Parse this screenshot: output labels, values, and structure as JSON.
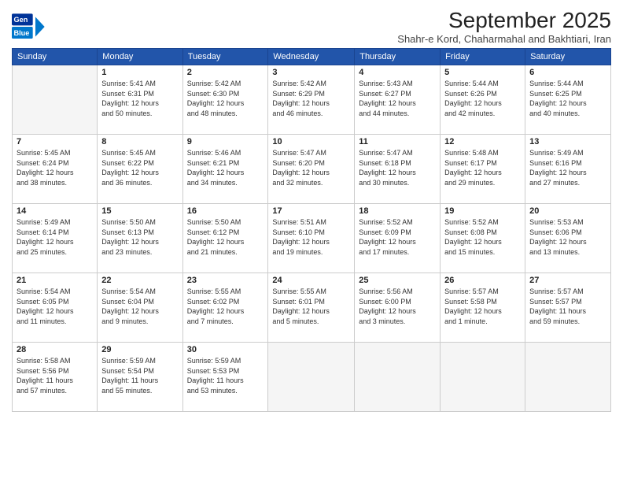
{
  "logo": {
    "line1": "General",
    "line2": "Blue"
  },
  "title": "September 2025",
  "subtitle": "Shahr-e Kord, Chaharmahal and Bakhtiari, Iran",
  "weekdays": [
    "Sunday",
    "Monday",
    "Tuesday",
    "Wednesday",
    "Thursday",
    "Friday",
    "Saturday"
  ],
  "weeks": [
    [
      {
        "day": "",
        "info": ""
      },
      {
        "day": "1",
        "info": "Sunrise: 5:41 AM\nSunset: 6:31 PM\nDaylight: 12 hours\nand 50 minutes."
      },
      {
        "day": "2",
        "info": "Sunrise: 5:42 AM\nSunset: 6:30 PM\nDaylight: 12 hours\nand 48 minutes."
      },
      {
        "day": "3",
        "info": "Sunrise: 5:42 AM\nSunset: 6:29 PM\nDaylight: 12 hours\nand 46 minutes."
      },
      {
        "day": "4",
        "info": "Sunrise: 5:43 AM\nSunset: 6:27 PM\nDaylight: 12 hours\nand 44 minutes."
      },
      {
        "day": "5",
        "info": "Sunrise: 5:44 AM\nSunset: 6:26 PM\nDaylight: 12 hours\nand 42 minutes."
      },
      {
        "day": "6",
        "info": "Sunrise: 5:44 AM\nSunset: 6:25 PM\nDaylight: 12 hours\nand 40 minutes."
      }
    ],
    [
      {
        "day": "7",
        "info": "Sunrise: 5:45 AM\nSunset: 6:24 PM\nDaylight: 12 hours\nand 38 minutes."
      },
      {
        "day": "8",
        "info": "Sunrise: 5:45 AM\nSunset: 6:22 PM\nDaylight: 12 hours\nand 36 minutes."
      },
      {
        "day": "9",
        "info": "Sunrise: 5:46 AM\nSunset: 6:21 PM\nDaylight: 12 hours\nand 34 minutes."
      },
      {
        "day": "10",
        "info": "Sunrise: 5:47 AM\nSunset: 6:20 PM\nDaylight: 12 hours\nand 32 minutes."
      },
      {
        "day": "11",
        "info": "Sunrise: 5:47 AM\nSunset: 6:18 PM\nDaylight: 12 hours\nand 30 minutes."
      },
      {
        "day": "12",
        "info": "Sunrise: 5:48 AM\nSunset: 6:17 PM\nDaylight: 12 hours\nand 29 minutes."
      },
      {
        "day": "13",
        "info": "Sunrise: 5:49 AM\nSunset: 6:16 PM\nDaylight: 12 hours\nand 27 minutes."
      }
    ],
    [
      {
        "day": "14",
        "info": "Sunrise: 5:49 AM\nSunset: 6:14 PM\nDaylight: 12 hours\nand 25 minutes."
      },
      {
        "day": "15",
        "info": "Sunrise: 5:50 AM\nSunset: 6:13 PM\nDaylight: 12 hours\nand 23 minutes."
      },
      {
        "day": "16",
        "info": "Sunrise: 5:50 AM\nSunset: 6:12 PM\nDaylight: 12 hours\nand 21 minutes."
      },
      {
        "day": "17",
        "info": "Sunrise: 5:51 AM\nSunset: 6:10 PM\nDaylight: 12 hours\nand 19 minutes."
      },
      {
        "day": "18",
        "info": "Sunrise: 5:52 AM\nSunset: 6:09 PM\nDaylight: 12 hours\nand 17 minutes."
      },
      {
        "day": "19",
        "info": "Sunrise: 5:52 AM\nSunset: 6:08 PM\nDaylight: 12 hours\nand 15 minutes."
      },
      {
        "day": "20",
        "info": "Sunrise: 5:53 AM\nSunset: 6:06 PM\nDaylight: 12 hours\nand 13 minutes."
      }
    ],
    [
      {
        "day": "21",
        "info": "Sunrise: 5:54 AM\nSunset: 6:05 PM\nDaylight: 12 hours\nand 11 minutes."
      },
      {
        "day": "22",
        "info": "Sunrise: 5:54 AM\nSunset: 6:04 PM\nDaylight: 12 hours\nand 9 minutes."
      },
      {
        "day": "23",
        "info": "Sunrise: 5:55 AM\nSunset: 6:02 PM\nDaylight: 12 hours\nand 7 minutes."
      },
      {
        "day": "24",
        "info": "Sunrise: 5:55 AM\nSunset: 6:01 PM\nDaylight: 12 hours\nand 5 minutes."
      },
      {
        "day": "25",
        "info": "Sunrise: 5:56 AM\nSunset: 6:00 PM\nDaylight: 12 hours\nand 3 minutes."
      },
      {
        "day": "26",
        "info": "Sunrise: 5:57 AM\nSunset: 5:58 PM\nDaylight: 12 hours\nand 1 minute."
      },
      {
        "day": "27",
        "info": "Sunrise: 5:57 AM\nSunset: 5:57 PM\nDaylight: 11 hours\nand 59 minutes."
      }
    ],
    [
      {
        "day": "28",
        "info": "Sunrise: 5:58 AM\nSunset: 5:56 PM\nDaylight: 11 hours\nand 57 minutes."
      },
      {
        "day": "29",
        "info": "Sunrise: 5:59 AM\nSunset: 5:54 PM\nDaylight: 11 hours\nand 55 minutes."
      },
      {
        "day": "30",
        "info": "Sunrise: 5:59 AM\nSunset: 5:53 PM\nDaylight: 11 hours\nand 53 minutes."
      },
      {
        "day": "",
        "info": ""
      },
      {
        "day": "",
        "info": ""
      },
      {
        "day": "",
        "info": ""
      },
      {
        "day": "",
        "info": ""
      }
    ]
  ]
}
